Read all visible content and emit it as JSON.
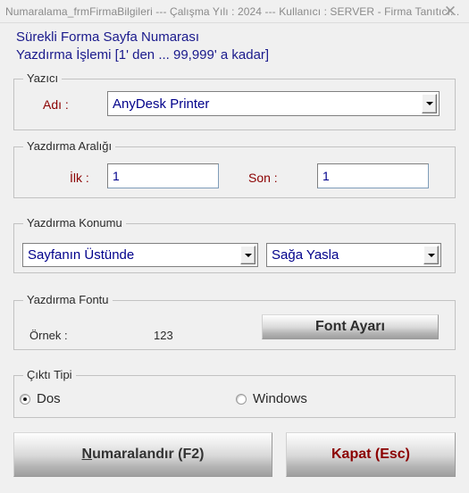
{
  "titlebar": {
    "text": "Numaralama_frmFirmaBilgileri  ---  Çalışma Yılı : 2024  ---  Kullanıcı : SERVER - Firma Tanıtıcı...",
    "close_icon": "close-icon",
    "close_glyph": "✕"
  },
  "heading": {
    "line1": "Sürekli Forma Sayfa Numarası",
    "line2": "Yazdırma İşlemi [1' den ... 99,999' a kadar]",
    "color": "#1a1a8c"
  },
  "printer_group": {
    "legend": "Yazıcı",
    "name_label": "Adı :",
    "name_value": "AnyDesk Printer",
    "dropdown_icon": "chevron-down-icon"
  },
  "range_group": {
    "legend": "Yazdırma Aralığı",
    "first_label": "İlk :",
    "first_value": "1",
    "last_label": "Son :",
    "last_value": "1"
  },
  "position_group": {
    "legend": "Yazdırma Konumu",
    "vertical_value": "Sayfanın Üstünde",
    "horizontal_value": "Sağa Yasla",
    "dropdown_icon": "chevron-down-icon"
  },
  "font_group": {
    "legend": "Yazdırma Fontu",
    "sample_label": "Örnek :",
    "sample_value": "123",
    "settings_button": "Font Ayarı"
  },
  "output_group": {
    "legend": "Çıktı Tipi",
    "options": [
      {
        "label": "Dos",
        "selected": true
      },
      {
        "label": "Windows",
        "selected": false
      }
    ],
    "dos_label": "Dos",
    "windows_label": "Windows"
  },
  "actions": {
    "number_accel": "N",
    "number_rest": "umaralandır (F2)",
    "close_label": "Kapat (Esc)",
    "close_color": "#8b0000"
  }
}
